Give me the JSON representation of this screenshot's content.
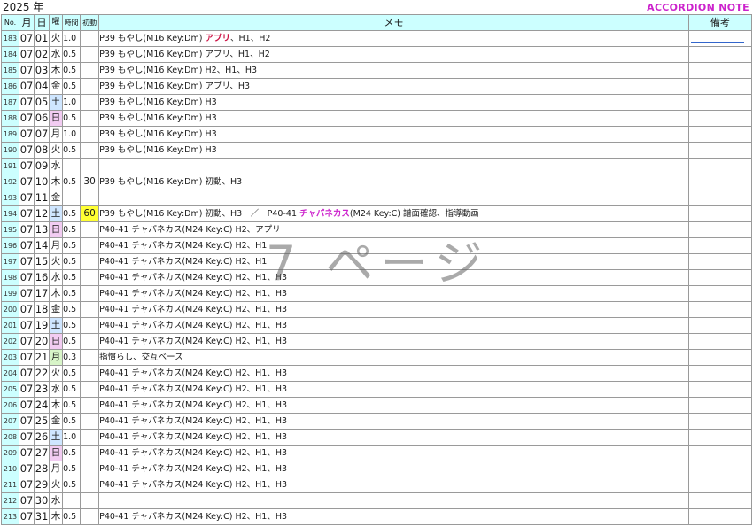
{
  "header": {
    "year": "2025 年",
    "brand": "ACCORDION NOTE"
  },
  "columns": {
    "no": "No.",
    "month": "月",
    "day": "日",
    "weekday": "曜",
    "time": "時間",
    "first_view": "初動",
    "memo": "メモ",
    "note": "備考"
  },
  "watermark": "7 ページ",
  "colors": {
    "header_bg": "#ccffff",
    "sunday_bg": "#f2ccf2",
    "saturday_bg": "#cfe6ff",
    "holiday_bg": "#d8f5c8",
    "highlight_bg": "#ffff33",
    "accent_magenta": "#cc22cc"
  },
  "rows": [
    {
      "no": "183",
      "m": "07",
      "d": "01",
      "w": "火",
      "h": "1.0",
      "s": "",
      "memo": [
        {
          "t": "P39 もやし(M16 Key:Dm) "
        },
        {
          "t": "アプリ",
          "c": "red"
        },
        {
          "t": "、H1、H2"
        }
      ],
      "note": "line"
    },
    {
      "no": "184",
      "m": "07",
      "d": "02",
      "w": "水",
      "h": "0.5",
      "s": "",
      "memo": [
        {
          "t": "P39 もやし(M16 Key:Dm) アプリ、H1、H2"
        }
      ]
    },
    {
      "no": "185",
      "m": "07",
      "d": "03",
      "w": "木",
      "h": "0.5",
      "s": "",
      "memo": [
        {
          "t": "P39 もやし(M16 Key:Dm) H2、H1、H3"
        }
      ]
    },
    {
      "no": "186",
      "m": "07",
      "d": "04",
      "w": "金",
      "h": "0.5",
      "s": "",
      "memo": [
        {
          "t": "P39 もやし(M16 Key:Dm) アプリ、H3"
        }
      ]
    },
    {
      "no": "187",
      "m": "07",
      "d": "05",
      "w": "土",
      "h": "1.0",
      "s": "",
      "memo": [
        {
          "t": "P39 もやし(M16 Key:Dm) H3"
        }
      ]
    },
    {
      "no": "188",
      "m": "07",
      "d": "06",
      "w": "日",
      "h": "0.5",
      "s": "",
      "memo": [
        {
          "t": "P39 もやし(M16 Key:Dm) H3"
        }
      ]
    },
    {
      "no": "189",
      "m": "07",
      "d": "07",
      "w": "月",
      "h": "1.0",
      "s": "",
      "memo": [
        {
          "t": "P39 もやし(M16 Key:Dm) H3"
        }
      ]
    },
    {
      "no": "190",
      "m": "07",
      "d": "08",
      "w": "火",
      "h": "0.5",
      "s": "",
      "memo": [
        {
          "t": "P39 もやし(M16 Key:Dm) H3"
        }
      ]
    },
    {
      "no": "191",
      "m": "07",
      "d": "09",
      "w": "水",
      "h": "",
      "s": "",
      "memo": []
    },
    {
      "no": "192",
      "m": "07",
      "d": "10",
      "w": "木",
      "h": "0.5",
      "s": "30",
      "memo": [
        {
          "t": "P39 もやし(M16 Key:Dm) 初動、H3"
        }
      ]
    },
    {
      "no": "193",
      "m": "07",
      "d": "11",
      "w": "金",
      "h": "",
      "s": "",
      "memo": []
    },
    {
      "no": "194",
      "m": "07",
      "d": "12",
      "w": "土",
      "h": "0.5",
      "s": "60",
      "hl": true,
      "memo": [
        {
          "t": "P39 もやし(M16 Key:Dm) 初動、H3　／　P40-41 "
        },
        {
          "t": "チャパネカス",
          "c": "mag"
        },
        {
          "t": "(M24 Key:C) 譜面確認、指導動画"
        }
      ]
    },
    {
      "no": "195",
      "m": "07",
      "d": "13",
      "w": "日",
      "h": "0.5",
      "s": "",
      "memo": [
        {
          "t": "P40-41 チャパネカス(M24 Key:C) H2、アプリ"
        }
      ]
    },
    {
      "no": "196",
      "m": "07",
      "d": "14",
      "w": "月",
      "h": "0.5",
      "s": "",
      "memo": [
        {
          "t": "P40-41 チャパネカス(M24 Key:C) H2、H1"
        }
      ]
    },
    {
      "no": "197",
      "m": "07",
      "d": "15",
      "w": "火",
      "h": "0.5",
      "s": "",
      "memo": [
        {
          "t": "P40-41 チャパネカス(M24 Key:C) H2、H1"
        }
      ]
    },
    {
      "no": "198",
      "m": "07",
      "d": "16",
      "w": "水",
      "h": "0.5",
      "s": "",
      "memo": [
        {
          "t": "P40-41 チャパネカス(M24 Key:C) H2、H1、H3"
        }
      ]
    },
    {
      "no": "199",
      "m": "07",
      "d": "17",
      "w": "木",
      "h": "0.5",
      "s": "",
      "memo": [
        {
          "t": "P40-41 チャパネカス(M24 Key:C) H2、H1、H3"
        }
      ]
    },
    {
      "no": "200",
      "m": "07",
      "d": "18",
      "w": "金",
      "h": "0.5",
      "s": "",
      "memo": [
        {
          "t": "P40-41 チャパネカス(M24 Key:C) H2、H1、H3"
        }
      ]
    },
    {
      "no": "201",
      "m": "07",
      "d": "19",
      "w": "土",
      "h": "0.5",
      "s": "",
      "memo": [
        {
          "t": "P40-41 チャパネカス(M24 Key:C) H2、H1、H3"
        }
      ]
    },
    {
      "no": "202",
      "m": "07",
      "d": "20",
      "w": "日",
      "h": "0.5",
      "s": "",
      "memo": [
        {
          "t": "P40-41 チャパネカス(M24 Key:C) H2、H1、H3"
        }
      ]
    },
    {
      "no": "203",
      "m": "07",
      "d": "21",
      "w": "月",
      "hol": true,
      "h": "0.3",
      "s": "",
      "memo": [
        {
          "t": "指慣らし、交互ベース"
        }
      ]
    },
    {
      "no": "204",
      "m": "07",
      "d": "22",
      "w": "火",
      "h": "0.5",
      "s": "",
      "memo": [
        {
          "t": "P40-41 チャパネカス(M24 Key:C) H2、H1、H3"
        }
      ]
    },
    {
      "no": "205",
      "m": "07",
      "d": "23",
      "w": "水",
      "h": "0.5",
      "s": "",
      "memo": [
        {
          "t": "P40-41 チャパネカス(M24 Key:C) H2、H1、H3"
        }
      ]
    },
    {
      "no": "206",
      "m": "07",
      "d": "24",
      "w": "木",
      "h": "0.5",
      "s": "",
      "memo": [
        {
          "t": "P40-41 チャパネカス(M24 Key:C) H2、H1、H3"
        }
      ]
    },
    {
      "no": "207",
      "m": "07",
      "d": "25",
      "w": "金",
      "h": "0.5",
      "s": "",
      "memo": [
        {
          "t": "P40-41 チャパネカス(M24 Key:C) H2、H1、H3"
        }
      ]
    },
    {
      "no": "208",
      "m": "07",
      "d": "26",
      "w": "土",
      "h": "1.0",
      "s": "",
      "memo": [
        {
          "t": "P40-41 チャパネカス(M24 Key:C) H2、H1、H3"
        }
      ]
    },
    {
      "no": "209",
      "m": "07",
      "d": "27",
      "w": "日",
      "h": "0.5",
      "s": "",
      "memo": [
        {
          "t": "P40-41 チャパネカス(M24 Key:C) H2、H1、H3"
        }
      ]
    },
    {
      "no": "210",
      "m": "07",
      "d": "28",
      "w": "月",
      "h": "0.5",
      "s": "",
      "memo": [
        {
          "t": "P40-41 チャパネカス(M24 Key:C) H2、H1、H3"
        }
      ]
    },
    {
      "no": "211",
      "m": "07",
      "d": "29",
      "w": "火",
      "h": "0.5",
      "s": "",
      "memo": [
        {
          "t": "P40-41 チャパネカス(M24 Key:C) H2、H1、H3"
        }
      ]
    },
    {
      "no": "212",
      "m": "07",
      "d": "30",
      "w": "水",
      "h": "",
      "s": "",
      "memo": []
    },
    {
      "no": "213",
      "m": "07",
      "d": "31",
      "w": "木",
      "h": "0.5",
      "s": "",
      "memo": [
        {
          "t": "P40-41 チャパネカス(M24 Key:C) H2、H1、H3"
        }
      ]
    }
  ]
}
